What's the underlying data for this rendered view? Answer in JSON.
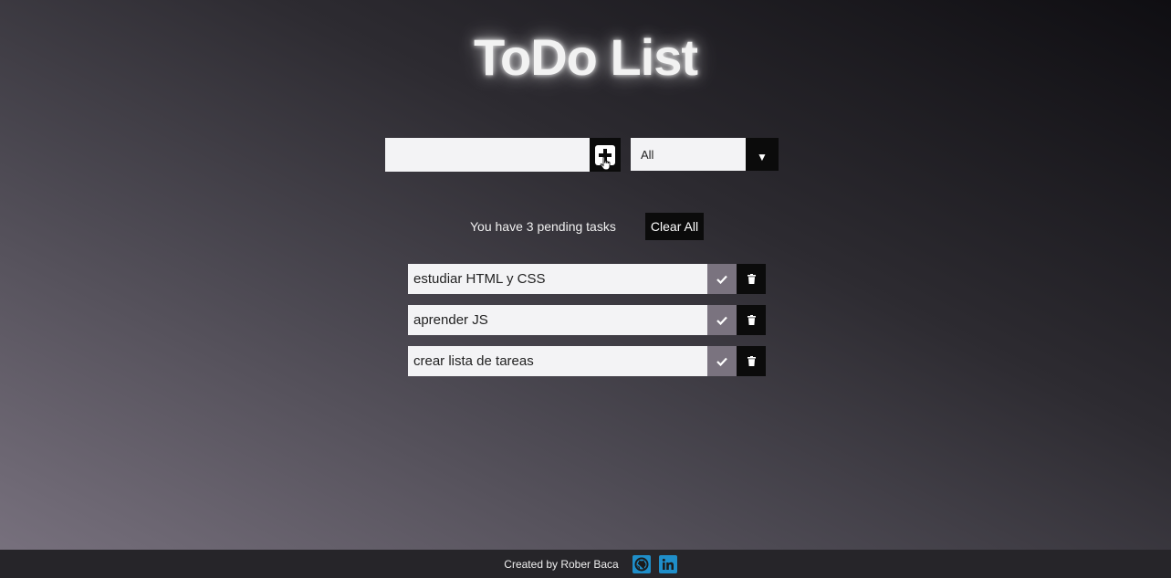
{
  "app": {
    "title": "ToDo List"
  },
  "form": {
    "input_value": "",
    "input_placeholder": "",
    "add_icon": "plus-square-icon"
  },
  "filter": {
    "selected": "All",
    "arrow_glyph": "▼"
  },
  "status": {
    "pending_text": "You have 3 pending tasks",
    "clear_label": "Clear All"
  },
  "todos": [
    {
      "text": "estudiar HTML y CSS"
    },
    {
      "text": "aprender JS"
    },
    {
      "text": "crear lista de tareas"
    }
  ],
  "footer": {
    "credit": "Created by Rober Baca",
    "links": [
      "github-icon",
      "linkedin-icon"
    ]
  },
  "colors": {
    "accent_black": "#0b0b0b",
    "check_button": "#7a737f",
    "social_blue": "#1f8ec9",
    "field_bg": "#f3f3f5"
  }
}
